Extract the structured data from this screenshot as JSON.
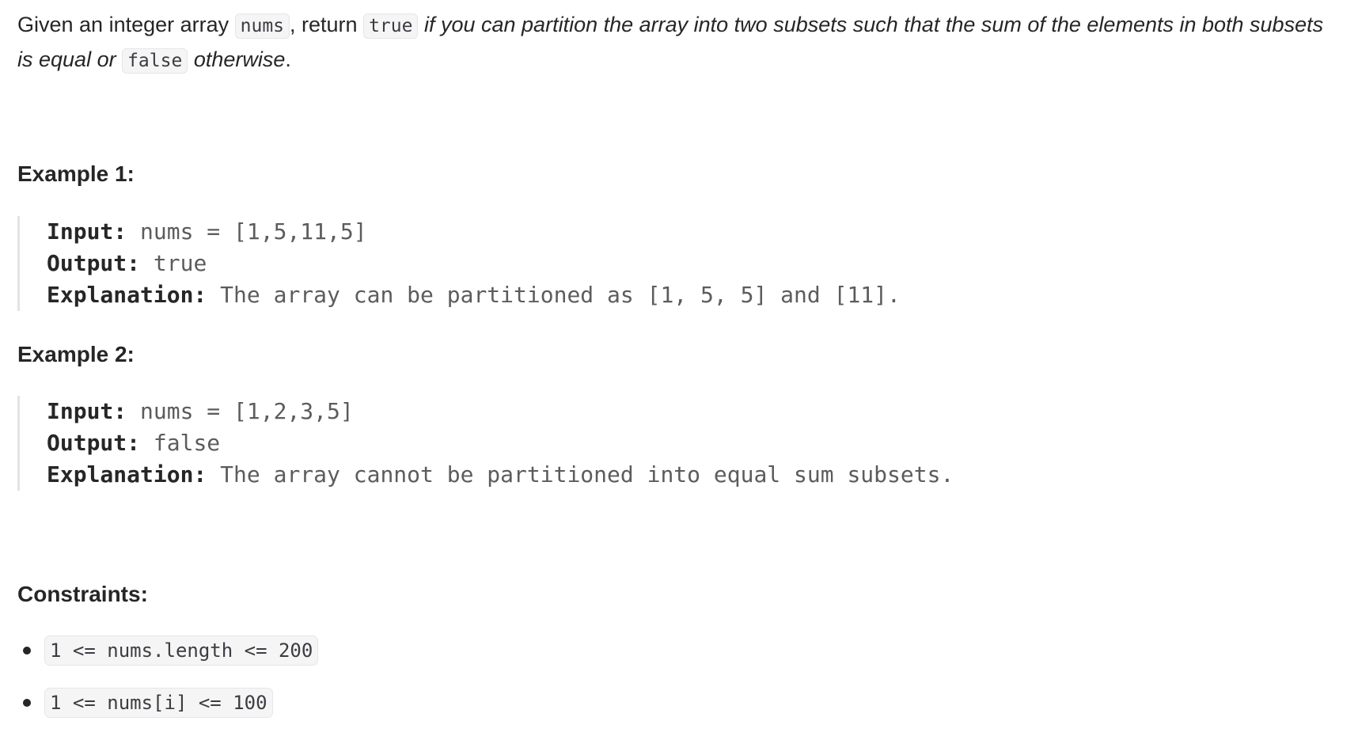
{
  "description": {
    "part1": "Given an integer array ",
    "code_nums": "nums",
    "part2": ", return ",
    "code_true": "true",
    "part3_italic": " if you can partition the array into two subsets such that the sum of the elements in both subsets is equal or ",
    "code_false": "false",
    "part4_italic": " otherwise",
    "part5": "."
  },
  "examples": [
    {
      "title": "Example 1:",
      "input_label": "Input:",
      "input_value": " nums = [1,5,11,5]",
      "output_label": "Output:",
      "output_value": " true",
      "explanation_label": "Explanation:",
      "explanation_value": " The array can be partitioned as [1, 5, 5] and [11]."
    },
    {
      "title": "Example 2:",
      "input_label": "Input:",
      "input_value": " nums = [1,2,3,5]",
      "output_label": "Output:",
      "output_value": " false",
      "explanation_label": "Explanation:",
      "explanation_value": " The array cannot be partitioned into equal sum subsets."
    }
  ],
  "constraints": {
    "title": "Constraints:",
    "items": [
      "1 <= nums.length <= 200",
      "1 <= nums[i] <= 100"
    ]
  }
}
